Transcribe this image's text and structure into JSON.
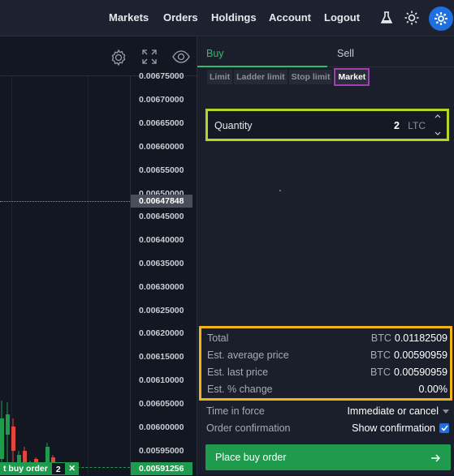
{
  "nav": {
    "items": [
      "Markets",
      "Orders",
      "Holdings",
      "Account",
      "Logout"
    ],
    "icons": [
      "flask-icon",
      "sun-icon",
      "gear-icon"
    ],
    "accent": "#1f6fe0"
  },
  "chart": {
    "toolbar_icons": [
      "settings-icon",
      "fullscreen-icon",
      "eye-icon"
    ],
    "ticks": [
      "0.00675000",
      "0.00670000",
      "0.00665000",
      "0.00660000",
      "0.00655000",
      "0.00650000",
      "0.00645000",
      "0.00640000",
      "0.00635000",
      "0.00630000",
      "0.00625000",
      "0.00620000",
      "0.00615000",
      "0.00610000",
      "0.00605000",
      "0.00600000",
      "0.00595000"
    ],
    "current_price": "0.00647848",
    "order_price": "0.00591256",
    "order_tag": {
      "label": "t buy order",
      "qty": "2",
      "close": "✕"
    },
    "colors": {
      "up": "#1f9b4e",
      "down": "#e0463c"
    }
  },
  "panel": {
    "tabs": {
      "buy": "Buy",
      "sell": "Sell"
    },
    "order_types": [
      "Limit",
      "Ladder limit",
      "Stop limit",
      "Market"
    ],
    "active_type": "Market",
    "quantity": {
      "label": "Quantity",
      "value": "2",
      "unit": "LTC"
    },
    "summary": [
      {
        "label": "Total",
        "currency": "BTC",
        "value": "0.01182509"
      },
      {
        "label": "Est. average price",
        "currency": "BTC",
        "value": "0.00590959"
      },
      {
        "label": "Est. last price",
        "currency": "BTC",
        "value": "0.00590959"
      },
      {
        "label": "Est. % change",
        "currency": "",
        "value": "0.00%"
      }
    ],
    "time_in_force": {
      "label": "Time in force",
      "value": "Immediate or cancel"
    },
    "order_confirmation": {
      "label": "Order confirmation",
      "value": "Show confirmation",
      "checked": true
    },
    "submit": "Place buy order"
  }
}
